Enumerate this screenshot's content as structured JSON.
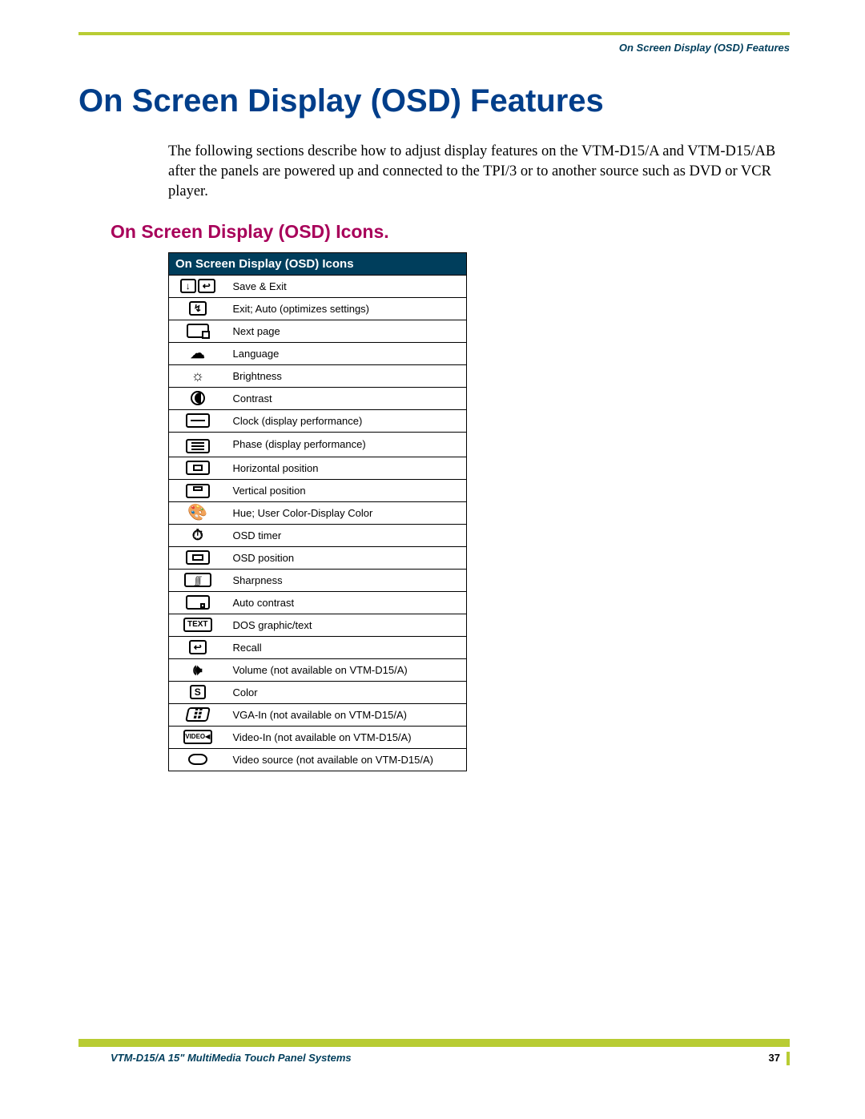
{
  "running_head": "On Screen Display (OSD) Features",
  "title": "On Screen Display (OSD) Features",
  "intro": "The following sections describe how to adjust display features on the VTM-D15/A and VTM-D15/AB after the panels are powered up and connected to the TPI/3 or to another source such as DVD or VCR player.",
  "section_heading": "On Screen Display (OSD) Icons.",
  "table_header": "On Screen Display (OSD) Icons",
  "icons": [
    {
      "name": "save-exit-icon",
      "desc": "Save & Exit"
    },
    {
      "name": "exit-auto-icon",
      "desc": "Exit; Auto (optimizes settings)"
    },
    {
      "name": "next-page-icon",
      "desc": "Next page"
    },
    {
      "name": "language-icon",
      "desc": "Language"
    },
    {
      "name": "brightness-icon",
      "desc": "Brightness"
    },
    {
      "name": "contrast-icon",
      "desc": "Contrast"
    },
    {
      "name": "clock-icon",
      "desc": "Clock (display performance)"
    },
    {
      "name": "phase-icon",
      "desc": "Phase (display performance)"
    },
    {
      "name": "h-position-icon",
      "desc": "Horizontal position"
    },
    {
      "name": "v-position-icon",
      "desc": "Vertical position"
    },
    {
      "name": "hue-color-icon",
      "desc": "Hue; User Color-Display Color"
    },
    {
      "name": "osd-timer-icon",
      "desc": "OSD timer"
    },
    {
      "name": "osd-position-icon",
      "desc": "OSD position"
    },
    {
      "name": "sharpness-icon",
      "desc": "Sharpness"
    },
    {
      "name": "auto-contrast-icon",
      "desc": "Auto contrast"
    },
    {
      "name": "dos-text-icon",
      "desc": "DOS graphic/text"
    },
    {
      "name": "recall-icon",
      "desc": "Recall"
    },
    {
      "name": "volume-icon",
      "desc": "Volume (not available on VTM-D15/A)"
    },
    {
      "name": "color-icon",
      "desc": "Color"
    },
    {
      "name": "vga-in-icon",
      "desc": "VGA-In (not available on VTM-D15/A)"
    },
    {
      "name": "video-in-icon",
      "desc": "Video-In (not available on VTM-D15/A)"
    },
    {
      "name": "video-source-icon",
      "desc": "Video source (not available on VTM-D15/A)"
    }
  ],
  "footer_left": "VTM-D15/A 15\" MultiMedia Touch Panel Systems",
  "footer_right": "37"
}
